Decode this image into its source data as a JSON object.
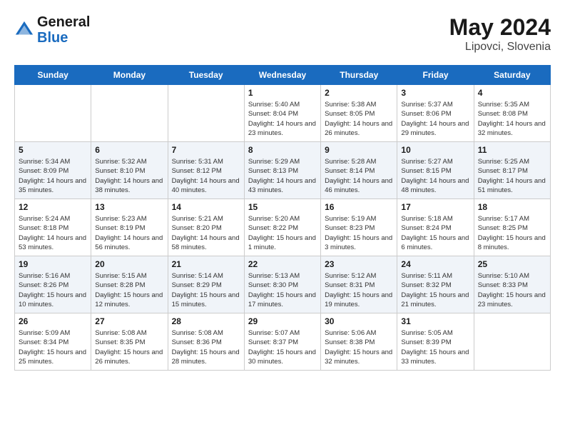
{
  "header": {
    "logo_line1": "General",
    "logo_line2": "Blue",
    "month_year": "May 2024",
    "location": "Lipovci, Slovenia"
  },
  "weekdays": [
    "Sunday",
    "Monday",
    "Tuesday",
    "Wednesday",
    "Thursday",
    "Friday",
    "Saturday"
  ],
  "weeks": [
    [
      {
        "day": "",
        "sunrise": "",
        "sunset": "",
        "daylight": ""
      },
      {
        "day": "",
        "sunrise": "",
        "sunset": "",
        "daylight": ""
      },
      {
        "day": "",
        "sunrise": "",
        "sunset": "",
        "daylight": ""
      },
      {
        "day": "1",
        "sunrise": "Sunrise: 5:40 AM",
        "sunset": "Sunset: 8:04 PM",
        "daylight": "Daylight: 14 hours and 23 minutes."
      },
      {
        "day": "2",
        "sunrise": "Sunrise: 5:38 AM",
        "sunset": "Sunset: 8:05 PM",
        "daylight": "Daylight: 14 hours and 26 minutes."
      },
      {
        "day": "3",
        "sunrise": "Sunrise: 5:37 AM",
        "sunset": "Sunset: 8:06 PM",
        "daylight": "Daylight: 14 hours and 29 minutes."
      },
      {
        "day": "4",
        "sunrise": "Sunrise: 5:35 AM",
        "sunset": "Sunset: 8:08 PM",
        "daylight": "Daylight: 14 hours and 32 minutes."
      }
    ],
    [
      {
        "day": "5",
        "sunrise": "Sunrise: 5:34 AM",
        "sunset": "Sunset: 8:09 PM",
        "daylight": "Daylight: 14 hours and 35 minutes."
      },
      {
        "day": "6",
        "sunrise": "Sunrise: 5:32 AM",
        "sunset": "Sunset: 8:10 PM",
        "daylight": "Daylight: 14 hours and 38 minutes."
      },
      {
        "day": "7",
        "sunrise": "Sunrise: 5:31 AM",
        "sunset": "Sunset: 8:12 PM",
        "daylight": "Daylight: 14 hours and 40 minutes."
      },
      {
        "day": "8",
        "sunrise": "Sunrise: 5:29 AM",
        "sunset": "Sunset: 8:13 PM",
        "daylight": "Daylight: 14 hours and 43 minutes."
      },
      {
        "day": "9",
        "sunrise": "Sunrise: 5:28 AM",
        "sunset": "Sunset: 8:14 PM",
        "daylight": "Daylight: 14 hours and 46 minutes."
      },
      {
        "day": "10",
        "sunrise": "Sunrise: 5:27 AM",
        "sunset": "Sunset: 8:15 PM",
        "daylight": "Daylight: 14 hours and 48 minutes."
      },
      {
        "day": "11",
        "sunrise": "Sunrise: 5:25 AM",
        "sunset": "Sunset: 8:17 PM",
        "daylight": "Daylight: 14 hours and 51 minutes."
      }
    ],
    [
      {
        "day": "12",
        "sunrise": "Sunrise: 5:24 AM",
        "sunset": "Sunset: 8:18 PM",
        "daylight": "Daylight: 14 hours and 53 minutes."
      },
      {
        "day": "13",
        "sunrise": "Sunrise: 5:23 AM",
        "sunset": "Sunset: 8:19 PM",
        "daylight": "Daylight: 14 hours and 56 minutes."
      },
      {
        "day": "14",
        "sunrise": "Sunrise: 5:21 AM",
        "sunset": "Sunset: 8:20 PM",
        "daylight": "Daylight: 14 hours and 58 minutes."
      },
      {
        "day": "15",
        "sunrise": "Sunrise: 5:20 AM",
        "sunset": "Sunset: 8:22 PM",
        "daylight": "Daylight: 15 hours and 1 minute."
      },
      {
        "day": "16",
        "sunrise": "Sunrise: 5:19 AM",
        "sunset": "Sunset: 8:23 PM",
        "daylight": "Daylight: 15 hours and 3 minutes."
      },
      {
        "day": "17",
        "sunrise": "Sunrise: 5:18 AM",
        "sunset": "Sunset: 8:24 PM",
        "daylight": "Daylight: 15 hours and 6 minutes."
      },
      {
        "day": "18",
        "sunrise": "Sunrise: 5:17 AM",
        "sunset": "Sunset: 8:25 PM",
        "daylight": "Daylight: 15 hours and 8 minutes."
      }
    ],
    [
      {
        "day": "19",
        "sunrise": "Sunrise: 5:16 AM",
        "sunset": "Sunset: 8:26 PM",
        "daylight": "Daylight: 15 hours and 10 minutes."
      },
      {
        "day": "20",
        "sunrise": "Sunrise: 5:15 AM",
        "sunset": "Sunset: 8:28 PM",
        "daylight": "Daylight: 15 hours and 12 minutes."
      },
      {
        "day": "21",
        "sunrise": "Sunrise: 5:14 AM",
        "sunset": "Sunset: 8:29 PM",
        "daylight": "Daylight: 15 hours and 15 minutes."
      },
      {
        "day": "22",
        "sunrise": "Sunrise: 5:13 AM",
        "sunset": "Sunset: 8:30 PM",
        "daylight": "Daylight: 15 hours and 17 minutes."
      },
      {
        "day": "23",
        "sunrise": "Sunrise: 5:12 AM",
        "sunset": "Sunset: 8:31 PM",
        "daylight": "Daylight: 15 hours and 19 minutes."
      },
      {
        "day": "24",
        "sunrise": "Sunrise: 5:11 AM",
        "sunset": "Sunset: 8:32 PM",
        "daylight": "Daylight: 15 hours and 21 minutes."
      },
      {
        "day": "25",
        "sunrise": "Sunrise: 5:10 AM",
        "sunset": "Sunset: 8:33 PM",
        "daylight": "Daylight: 15 hours and 23 minutes."
      }
    ],
    [
      {
        "day": "26",
        "sunrise": "Sunrise: 5:09 AM",
        "sunset": "Sunset: 8:34 PM",
        "daylight": "Daylight: 15 hours and 25 minutes."
      },
      {
        "day": "27",
        "sunrise": "Sunrise: 5:08 AM",
        "sunset": "Sunset: 8:35 PM",
        "daylight": "Daylight: 15 hours and 26 minutes."
      },
      {
        "day": "28",
        "sunrise": "Sunrise: 5:08 AM",
        "sunset": "Sunset: 8:36 PM",
        "daylight": "Daylight: 15 hours and 28 minutes."
      },
      {
        "day": "29",
        "sunrise": "Sunrise: 5:07 AM",
        "sunset": "Sunset: 8:37 PM",
        "daylight": "Daylight: 15 hours and 30 minutes."
      },
      {
        "day": "30",
        "sunrise": "Sunrise: 5:06 AM",
        "sunset": "Sunset: 8:38 PM",
        "daylight": "Daylight: 15 hours and 32 minutes."
      },
      {
        "day": "31",
        "sunrise": "Sunrise: 5:05 AM",
        "sunset": "Sunset: 8:39 PM",
        "daylight": "Daylight: 15 hours and 33 minutes."
      },
      {
        "day": "",
        "sunrise": "",
        "sunset": "",
        "daylight": ""
      }
    ]
  ]
}
